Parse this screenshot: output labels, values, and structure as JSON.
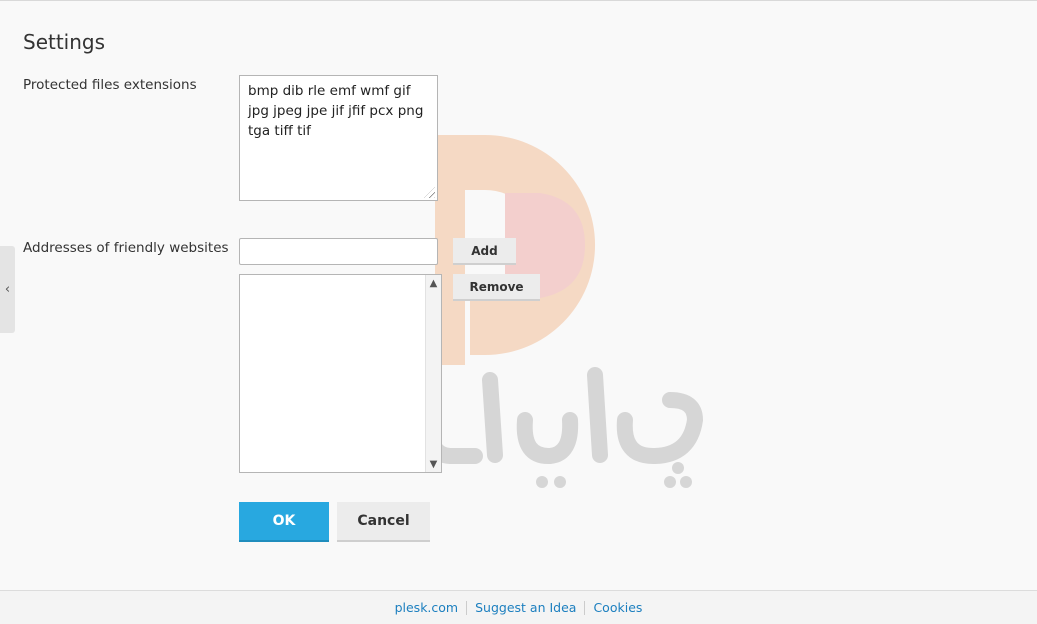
{
  "form": {
    "title": "Settings",
    "protected_label": "Protected files extensions",
    "protected_value": "bmp dib rle emf wmf gif jpg jpeg jpe jif jfif pcx png tga tiff tif",
    "friendly_label": "Addresses of friendly websites",
    "friendly_input_value": "",
    "add_label": "Add",
    "remove_label": "Remove",
    "friendly_list": [],
    "ok_label": "OK",
    "cancel_label": "Cancel"
  },
  "footer": {
    "links": [
      "plesk.com",
      "Suggest an Idea",
      "Cookies"
    ]
  },
  "icons": {
    "side_handle": "chevron-left-icon",
    "scroll_up": "chevron-up-icon",
    "scroll_down": "chevron-down-icon",
    "resize": "resize-grip-icon"
  },
  "colors": {
    "ok_button": "#28a8e0",
    "link": "#1c7fbf",
    "watermark_orange": "#f5d9c4",
    "watermark_pink": "#f3d0cf",
    "watermark_gray": "#d6d6d6"
  }
}
